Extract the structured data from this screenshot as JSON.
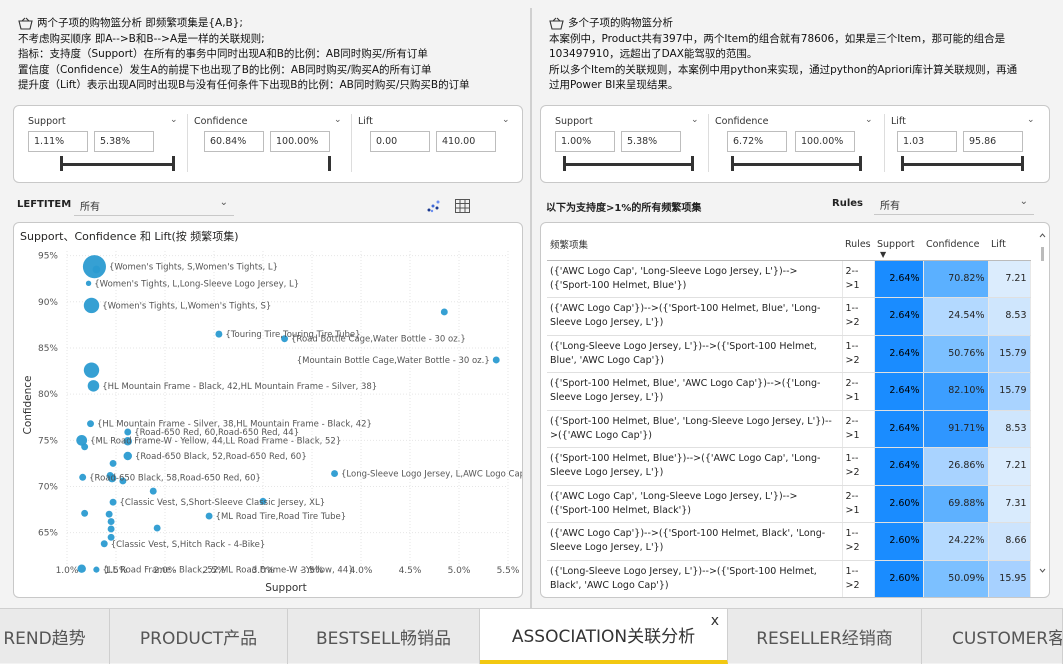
{
  "left_text": {
    "title": "两个子项的购物篮分析  即频繁项集是{A,B};",
    "lines": [
      "不考虑购买顺序  即A-->B和B-->A是一样的关联规则;",
      "指标：支持度（Support）在所有的事务中同时出现A和B的比例：AB同时购买/所有订单",
      "置信度（Confidence）发生A的前提下也出现了B的比例：AB同时购买/购买A的所有订单",
      "提升度（Lift）表示出现A同时出现B与没有任何条件下出现B的比例：AB同时购买/只购买B的订单"
    ]
  },
  "right_text": {
    "title": "多个子项的购物篮分析",
    "lines": [
      "本案例中，Product共有397中，两个Item的组合就有78606，如果是三个Item，那可能的组合是",
      "103497910，远超出了DAX能驾驭的范围。",
      "所以多个Item的关联规则，本案例中用python来实现，通过python的Apriori库计算关联规则，再通",
      "过用Power BI来呈现结果。"
    ]
  },
  "left_slicers": [
    {
      "label": "Support",
      "min": "1.11%",
      "max": "5.38%"
    },
    {
      "label": "Confidence",
      "min": "60.84%",
      "max": "100.00%"
    },
    {
      "label": "Lift",
      "min": "0.00",
      "max": "410.00"
    }
  ],
  "right_slicers": [
    {
      "label": "Support",
      "min": "1.00%",
      "max": "5.38%"
    },
    {
      "label": "Confidence",
      "min": "6.72%",
      "max": "100.00%"
    },
    {
      "label": "Lift",
      "min": "1.03",
      "max": "95.86"
    }
  ],
  "left_filter": {
    "label": "LEFTITEM",
    "value": "所有"
  },
  "right_filter": {
    "caption": "以下为支持度>1%的所有频繁项集",
    "label": "Rules",
    "value": "所有"
  },
  "chart_data": {
    "type": "scatter",
    "title": "Support、Confidence 和 Lift(按 频繁项集)",
    "xlabel": "Support",
    "ylabel": "Confidence",
    "xlim": [
      1.0,
      5.5
    ],
    "ylim": [
      61.5,
      95.5
    ],
    "xticks": [
      "1.0%",
      "1.5%",
      "2.0%",
      "2.5%",
      "3.0%",
      "3.5%",
      "4.0%",
      "4.5%",
      "5.0%",
      "5.5%"
    ],
    "yticks": [
      "65%",
      "70%",
      "75%",
      "80%",
      "85%",
      "90%",
      "95%"
    ],
    "color": "#2b9bd1",
    "points": [
      {
        "x": 1.28,
        "y": 93.8,
        "size": 30,
        "label": "{Women's Tights, S,Women's Tights, L}"
      },
      {
        "x": 1.3,
        "y": 93.5,
        "size": 10,
        "label": ""
      },
      {
        "x": 1.22,
        "y": 92.0,
        "size": 7,
        "label": "{Women's Tights, L,Long-Sleeve Logo Jersey, L}"
      },
      {
        "x": 1.25,
        "y": 89.6,
        "size": 20,
        "label": "{Women's Tights, L,Women's Tights, S}"
      },
      {
        "x": 4.85,
        "y": 88.9,
        "size": 9,
        "label": ""
      },
      {
        "x": 3.22,
        "y": 86.0,
        "size": 9,
        "label": "{Road Bottle Cage,Water Bottle - 30 oz.}"
      },
      {
        "x": 2.55,
        "y": 86.5,
        "size": 9,
        "label": "{Touring Tire,Touring Tire Tube}"
      },
      {
        "x": 5.38,
        "y": 83.7,
        "size": 9,
        "label": "{Mountain Bottle Cage,Water Bottle - 30 oz.}"
      },
      {
        "x": 1.25,
        "y": 82.6,
        "size": 20,
        "label": ""
      },
      {
        "x": 1.27,
        "y": 80.9,
        "size": 15,
        "label": "{HL Mountain Frame - Black, 42,HL Mountain Frame - Silver, 38}"
      },
      {
        "x": 1.24,
        "y": 76.8,
        "size": 9,
        "label": "{HL Mountain Frame - Silver, 38,HL Mountain Frame - Black, 42}"
      },
      {
        "x": 1.62,
        "y": 75.9,
        "size": 9,
        "label": "{Road-650 Red, 60,Road-650 Red, 44}"
      },
      {
        "x": 1.15,
        "y": 75.0,
        "size": 14,
        "label": "{ML Road Frame-W - Yellow, 44,LL Road Frame - Black, 52}"
      },
      {
        "x": 1.18,
        "y": 74.3,
        "size": 9,
        "label": ""
      },
      {
        "x": 1.62,
        "y": 74.9,
        "size": 11,
        "label": ""
      },
      {
        "x": 1.62,
        "y": 73.3,
        "size": 11,
        "label": "{Road-650 Black, 52,Road-650 Red, 60}"
      },
      {
        "x": 1.47,
        "y": 72.5,
        "size": 9,
        "label": ""
      },
      {
        "x": 1.44,
        "y": 71.2,
        "size": 9,
        "label": ""
      },
      {
        "x": 1.16,
        "y": 71.0,
        "size": 9,
        "label": "{Road-650 Black, 58,Road-650 Red, 60}"
      },
      {
        "x": 1.46,
        "y": 70.9,
        "size": 11,
        "label": ""
      },
      {
        "x": 1.57,
        "y": 70.6,
        "size": 9,
        "label": ""
      },
      {
        "x": 3.73,
        "y": 71.4,
        "size": 9,
        "label": "{Long-Sleeve Logo Jersey, L,AWC Logo Cap}"
      },
      {
        "x": 1.88,
        "y": 69.5,
        "size": 9,
        "label": ""
      },
      {
        "x": 1.47,
        "y": 68.3,
        "size": 9,
        "label": "{Classic Vest, S,Short-Sleeve Classic Jersey, XL}"
      },
      {
        "x": 1.18,
        "y": 67.1,
        "size": 9,
        "label": ""
      },
      {
        "x": 1.43,
        "y": 67.0,
        "size": 9,
        "label": ""
      },
      {
        "x": 1.45,
        "y": 66.2,
        "size": 9,
        "label": ""
      },
      {
        "x": 2.45,
        "y": 66.8,
        "size": 9,
        "label": "{ML Road Tire,Road Tire Tube}"
      },
      {
        "x": 3.0,
        "y": 68.4,
        "size": 9,
        "label": ""
      },
      {
        "x": 1.92,
        "y": 65.5,
        "size": 9,
        "label": ""
      },
      {
        "x": 1.45,
        "y": 65.4,
        "size": 9,
        "label": ""
      },
      {
        "x": 1.38,
        "y": 63.8,
        "size": 9,
        "label": "{Classic Vest, S,Hitch Rack - 4-Bike}"
      },
      {
        "x": 1.45,
        "y": 64.5,
        "size": 9,
        "label": ""
      },
      {
        "x": 1.15,
        "y": 61.1,
        "size": 11,
        "label": ""
      },
      {
        "x": 1.3,
        "y": 61.0,
        "size": 8,
        "label": "{LL Road Frame - Black, 52,ML Road Frame-W - Yellow, 44}"
      }
    ]
  },
  "table": {
    "headers": [
      "频繁项集",
      "Rules",
      "Support",
      "Confidence",
      "Lift"
    ],
    "rows": [
      [
        "({'AWC Logo Cap', 'Long-Sleeve Logo Jersey, L'})-->({'Sport-100 Helmet, Blue'})",
        "2-->1",
        "2.64%",
        "70.82%",
        "7.21"
      ],
      [
        "({'AWC Logo Cap'})-->({'Sport-100 Helmet, Blue', 'Long-Sleeve Logo Jersey, L'})",
        "1-->2",
        "2.64%",
        "24.54%",
        "8.53"
      ],
      [
        "({'Long-Sleeve Logo Jersey, L'})-->({'Sport-100 Helmet, Blue', 'AWC Logo Cap'})",
        "1-->2",
        "2.64%",
        "50.76%",
        "15.79"
      ],
      [
        "({'Sport-100 Helmet, Blue', 'AWC Logo Cap'})-->({'Long-Sleeve Logo Jersey, L'})",
        "2-->1",
        "2.64%",
        "82.10%",
        "15.79"
      ],
      [
        "({'Sport-100 Helmet, Blue', 'Long-Sleeve Logo Jersey, L'})-->({'AWC Logo Cap'})",
        "2-->1",
        "2.64%",
        "91.71%",
        "8.53"
      ],
      [
        "({'Sport-100 Helmet, Blue'})-->({'AWC Logo Cap', 'Long-Sleeve Logo Jersey, L'})",
        "1-->2",
        "2.64%",
        "26.86%",
        "7.21"
      ],
      [
        "({'AWC Logo Cap', 'Long-Sleeve Logo Jersey, L'})-->({'Sport-100 Helmet, Black'})",
        "2-->1",
        "2.60%",
        "69.88%",
        "7.31"
      ],
      [
        "({'AWC Logo Cap'})-->({'Sport-100 Helmet, Black', 'Long-Sleeve Logo Jersey, L'})",
        "1-->2",
        "2.60%",
        "24.22%",
        "8.66"
      ],
      [
        "({'Long-Sleeve Logo Jersey, L'})-->({'Sport-100 Helmet, Black', 'AWC Logo Cap'})",
        "1-->2",
        "2.60%",
        "50.09%",
        "15.95"
      ]
    ],
    "conf_colors": [
      "#5bb0ff",
      "#b3d9ff",
      "#7cc0ff",
      "#3c9eff",
      "#2f96ff",
      "#a9d3ff",
      "#5eb1ff",
      "#b5daff",
      "#7cc0ff"
    ],
    "lift_colors": [
      "#dbecfd",
      "#cfe6fd",
      "#a9d3ff",
      "#a9d3ff",
      "#cfe6fd",
      "#dbecfd",
      "#d9ebfd",
      "#cde4fd",
      "#a7d1ff"
    ]
  },
  "tabs": [
    {
      "label": "REND趋势"
    },
    {
      "label": "PRODUCT产品"
    },
    {
      "label": "BESTSELL畅销品"
    },
    {
      "label": "ASSOCIATION关联分析",
      "close": "x"
    },
    {
      "label": "RESELLER经销商"
    },
    {
      "label": "CUSTOMER客"
    }
  ]
}
